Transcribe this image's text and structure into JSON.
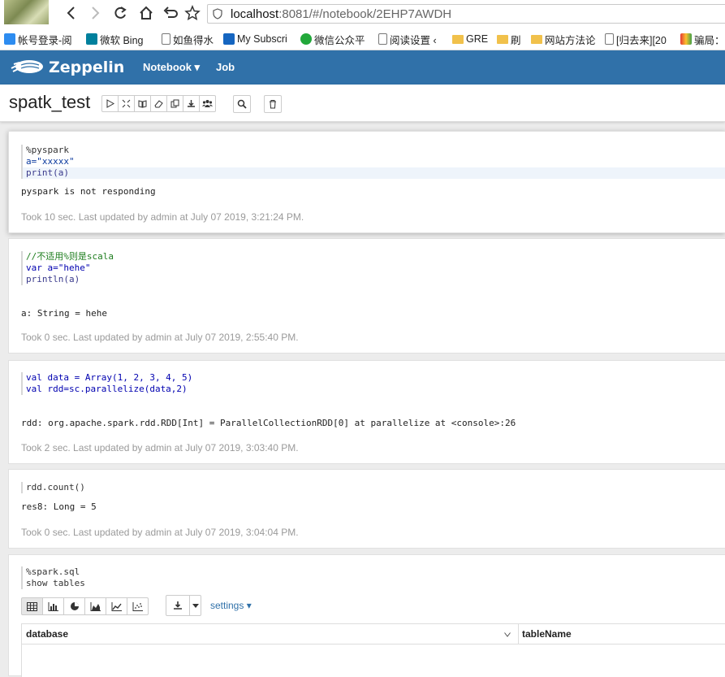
{
  "browser": {
    "url_host": "localhost",
    "url_rest": ":8081/#/notebook/2EHP7AWDH",
    "bookmarks": [
      {
        "label": "帐号登录-阅",
        "icon": "qq-icon",
        "color": "#2d8cf0"
      },
      {
        "label": "微软 Bing",
        "icon": "bing-icon",
        "color": "#00809d"
      },
      {
        "label": "如鱼得水",
        "icon": "page-icon",
        "color": "#777777"
      },
      {
        "label": "My Subscri",
        "icon": "v-icon",
        "color": "#1565c0"
      },
      {
        "label": "微信公众平",
        "icon": "wechat-icon",
        "color": "#22a83a"
      },
      {
        "label": "阅读设置 ‹",
        "icon": "page-icon",
        "color": "#777777"
      },
      {
        "label": "GRE",
        "icon": "folder-icon",
        "color": "#f1c14b"
      },
      {
        "label": "刷",
        "icon": "folder-icon",
        "color": "#f1c14b"
      },
      {
        "label": "网站方法论",
        "icon": "folder-icon",
        "color": "#f1c14b"
      },
      {
        "label": "[归去来][20",
        "icon": "page-icon",
        "color": "#777777"
      },
      {
        "label": "骗局：",
        "icon": "colorful-icon",
        "color": "#e53935"
      }
    ]
  },
  "navbar": {
    "brand": "Zeppelin",
    "menu_notebook": "Notebook ▾",
    "menu_job": "Job"
  },
  "notebook": {
    "title": "spatk_test"
  },
  "paragraphs": [
    {
      "code": [
        "%pyspark",
        "a=\"xxxxx\"",
        "print(a)"
      ],
      "output": "pyspark is not responding",
      "status": "Took 10 sec. Last updated by admin at July 07 2019, 3:21:24 PM."
    },
    {
      "code": [
        "//不适用%则是scala",
        "var a=\"hehe\"",
        "println(a)"
      ],
      "output": "a: String = hehe",
      "status": "Took 0 sec. Last updated by admin at July 07 2019, 2:55:40 PM."
    },
    {
      "code": [
        "val data = Array(1, 2, 3, 4, 5)",
        "val rdd=sc.parallelize(data,2)"
      ],
      "output": "rdd: org.apache.spark.rdd.RDD[Int] = ParallelCollectionRDD[0] at parallelize at <console>:26",
      "status": "Took 2 sec. Last updated by admin at July 07 2019, 3:03:40 PM."
    },
    {
      "code": [
        "rdd.count()"
      ],
      "output": "res8: Long = 5",
      "status": "Took 0 sec. Last updated by admin at July 07 2019, 3:04:04 PM."
    },
    {
      "code": [
        "%spark.sql",
        "show tables"
      ],
      "settings_label": "settings ▾",
      "table_headers": [
        "database",
        "tableName"
      ]
    }
  ]
}
